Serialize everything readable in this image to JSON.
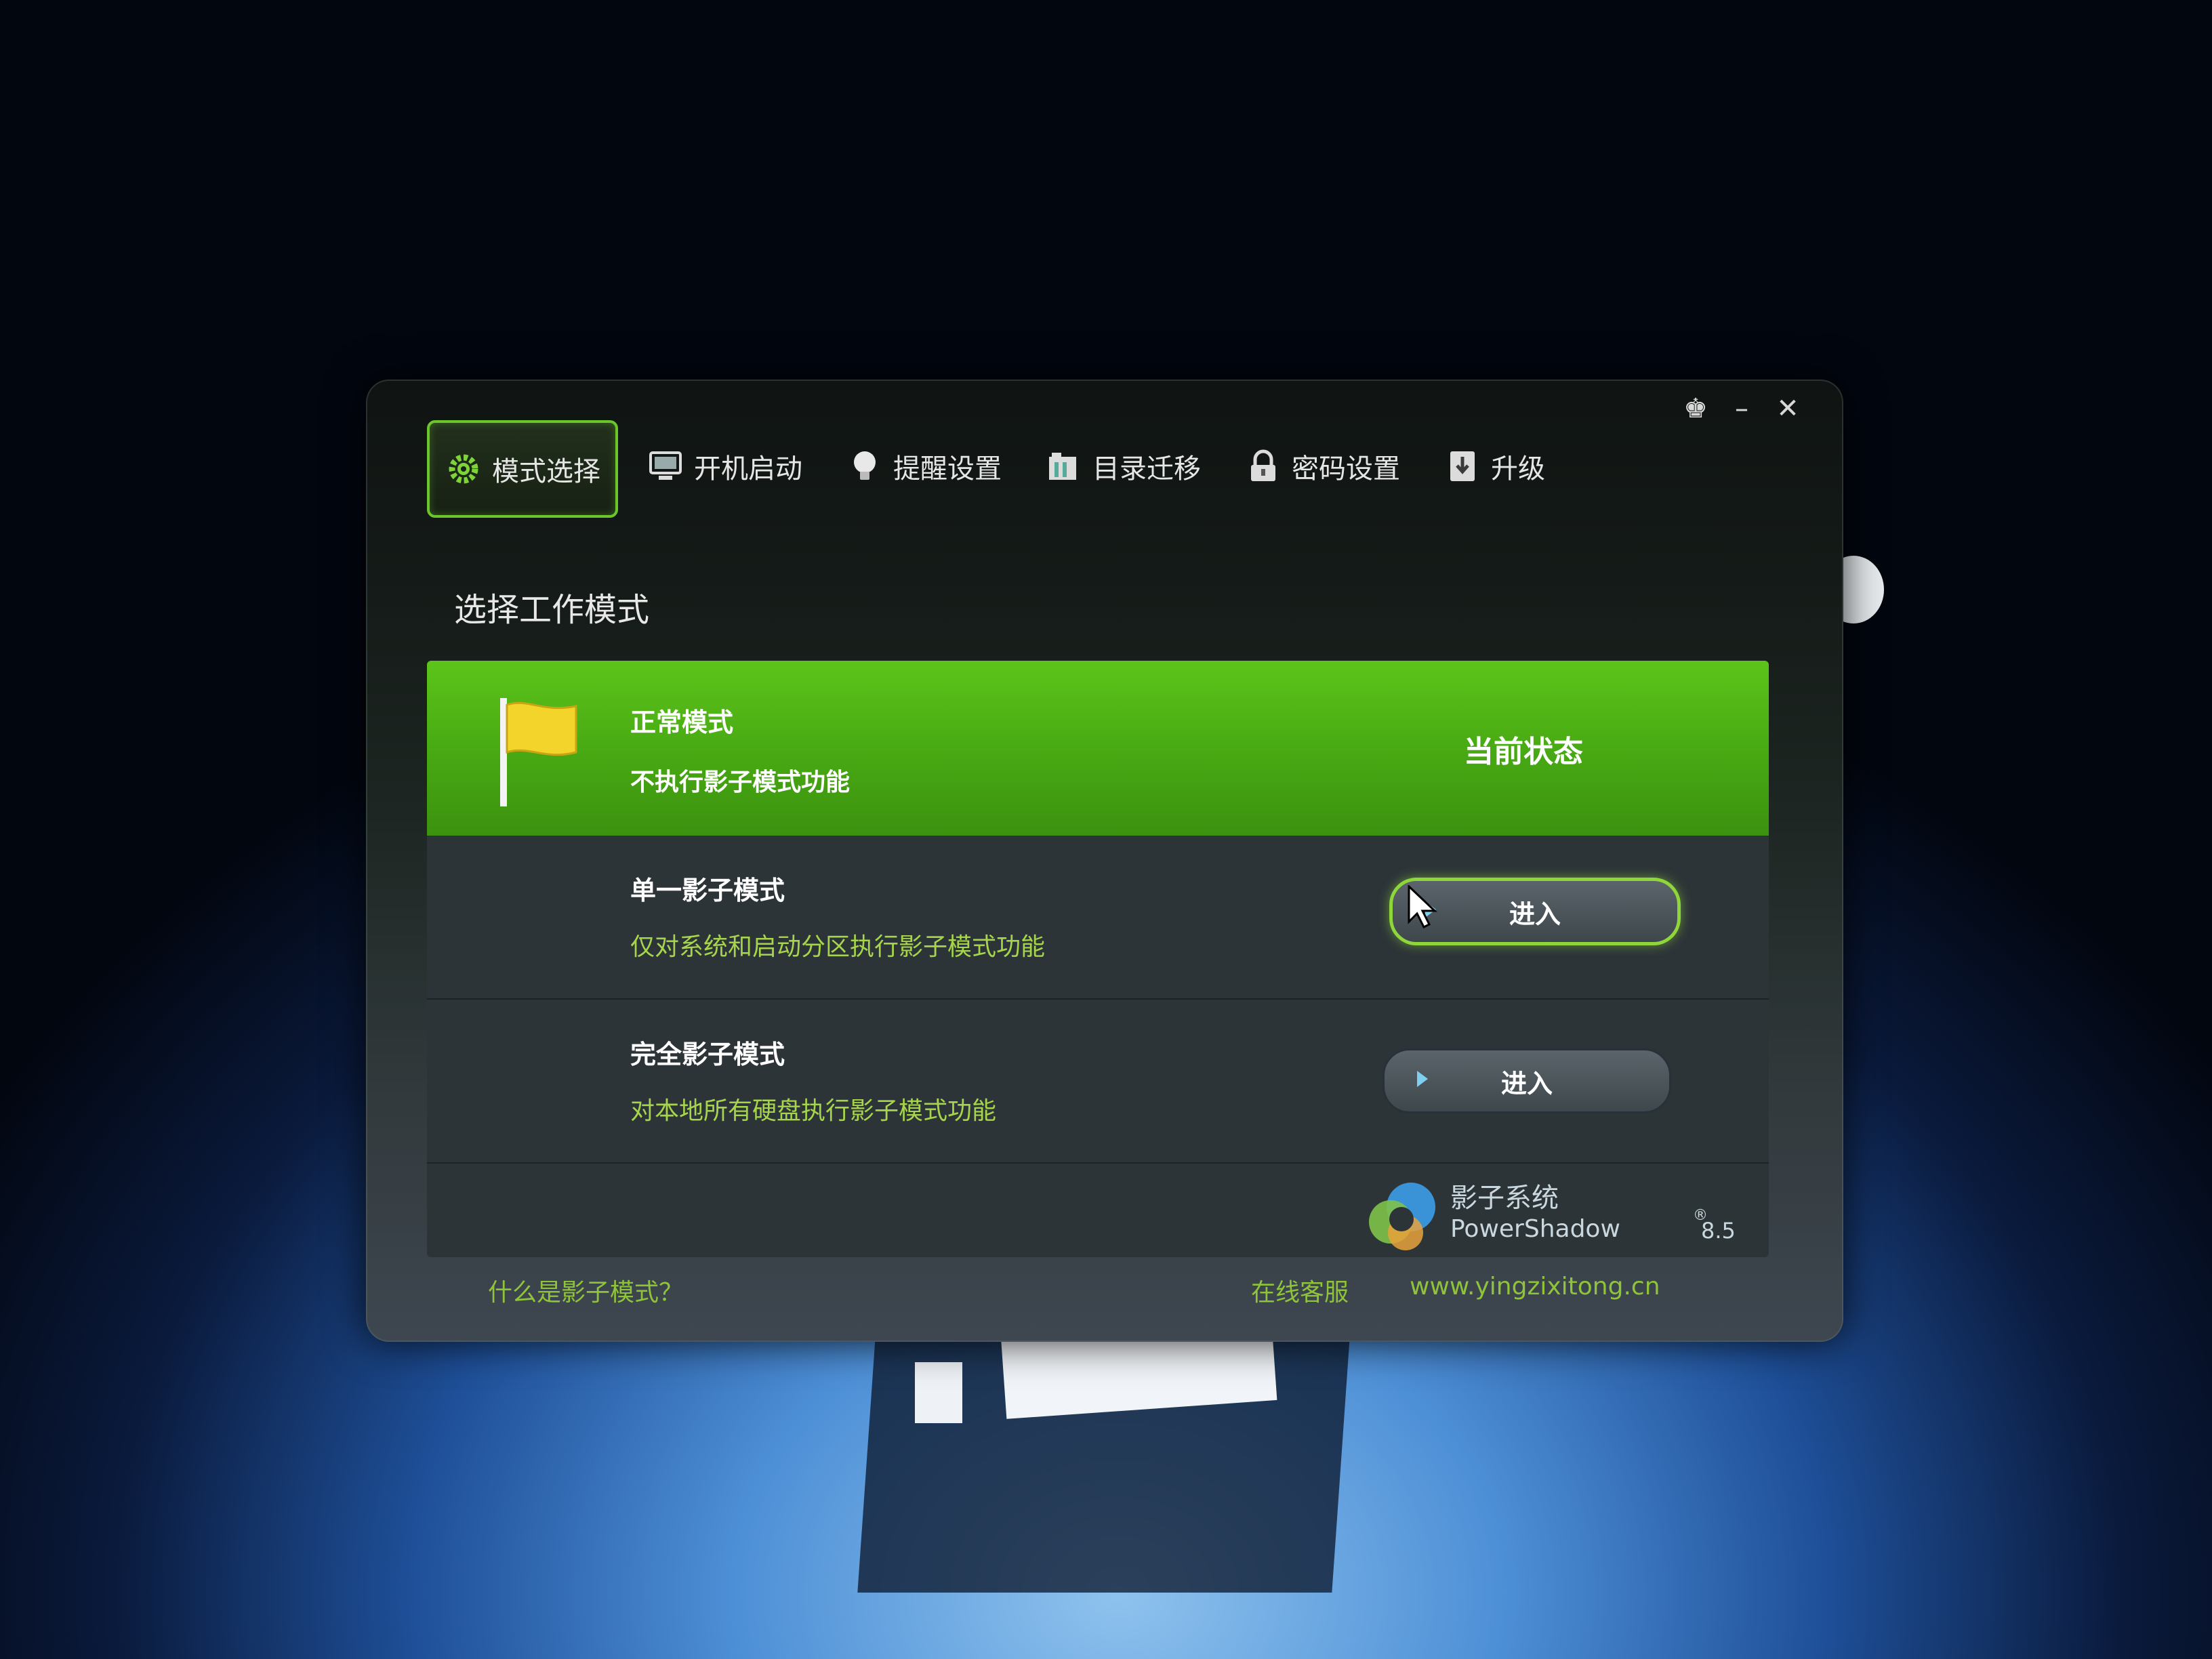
{
  "window_controls": {
    "skin": "♚",
    "minimize": "–",
    "close": "✕"
  },
  "tabs": [
    {
      "label": "模式选择",
      "icon": "gear-icon",
      "active": true
    },
    {
      "label": "开机启动",
      "icon": "monitor-icon",
      "active": false
    },
    {
      "label": "提醒设置",
      "icon": "bulb-icon",
      "active": false
    },
    {
      "label": "目录迁移",
      "icon": "folder-icon",
      "active": false
    },
    {
      "label": "密码设置",
      "icon": "lock-icon",
      "active": false
    },
    {
      "label": "升级",
      "icon": "download-icon",
      "active": false
    }
  ],
  "panel_title": "选择工作模式",
  "modes": {
    "normal": {
      "name": "正常模式",
      "desc": "不执行影子模式功能",
      "status": "当前状态"
    },
    "single": {
      "name": "单一影子模式",
      "desc": "仅对系统和启动分区执行影子模式功能",
      "button": "进入"
    },
    "full": {
      "name": "完全影子模式",
      "desc": "对本地所有硬盘执行影子模式功能",
      "button": "进入"
    }
  },
  "brand": {
    "cn": "影子系统",
    "en": "PowerShadow",
    "reg": "®",
    "version": "8.5"
  },
  "footer": {
    "help": "什么是影子模式？",
    "support": "在线客服",
    "website": "www.yingzixitong.cn"
  },
  "colors": {
    "accent": "#6dc52c",
    "link": "#8fc33a",
    "current_row": "#4fb316"
  }
}
